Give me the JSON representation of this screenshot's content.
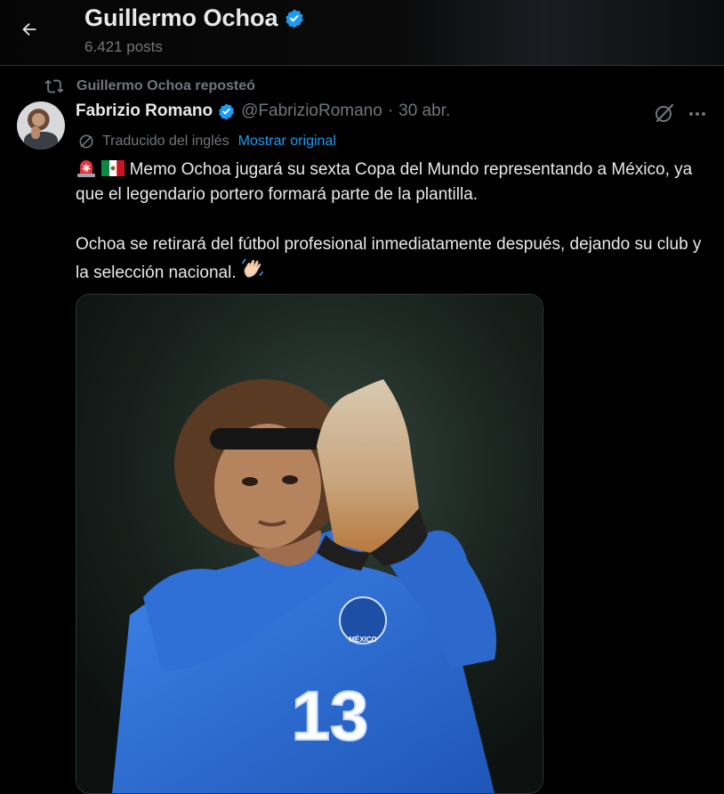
{
  "header": {
    "title": "Guillermo Ochoa",
    "posts_count": "6.421 posts"
  },
  "repost": {
    "label": "Guillermo Ochoa reposteó"
  },
  "tweet": {
    "author_name": "Fabrizio Romano",
    "author_handle": "@FabrizioRomano",
    "separator": "·",
    "date": "30 abr.",
    "translated_label": "Traducido del inglés",
    "show_original_label": "Mostrar original",
    "paragraph_1": "Memo Ochoa jugará su sexta Copa del Mundo representando a México, ya que el legendario portero formará parte de la plantilla.",
    "paragraph_2": "Ochoa se retirará del fútbol profesional inmediatamente después, dejando su club y la selección nacional.",
    "media_shirt_number": "13",
    "media_badge_text": "MÉXICO"
  },
  "icons": {
    "back": "arrow-left-icon",
    "verified": "verified-badge-icon",
    "repost": "repost-icon",
    "grok": "grok-icon",
    "more": "more-icon",
    "translate": "translate-icon",
    "siren_emoji": "siren-emoji-icon",
    "flag_emoji": "mexico-flag-emoji-icon",
    "wave_emoji": "waving-hand-emoji-icon"
  },
  "colors": {
    "background": "#000000",
    "text_primary": "#e7e9ea",
    "text_secondary": "#71767b",
    "link": "#1d9bf0",
    "verified": "#1d9bf0",
    "jersey": "#2f6fd6"
  }
}
